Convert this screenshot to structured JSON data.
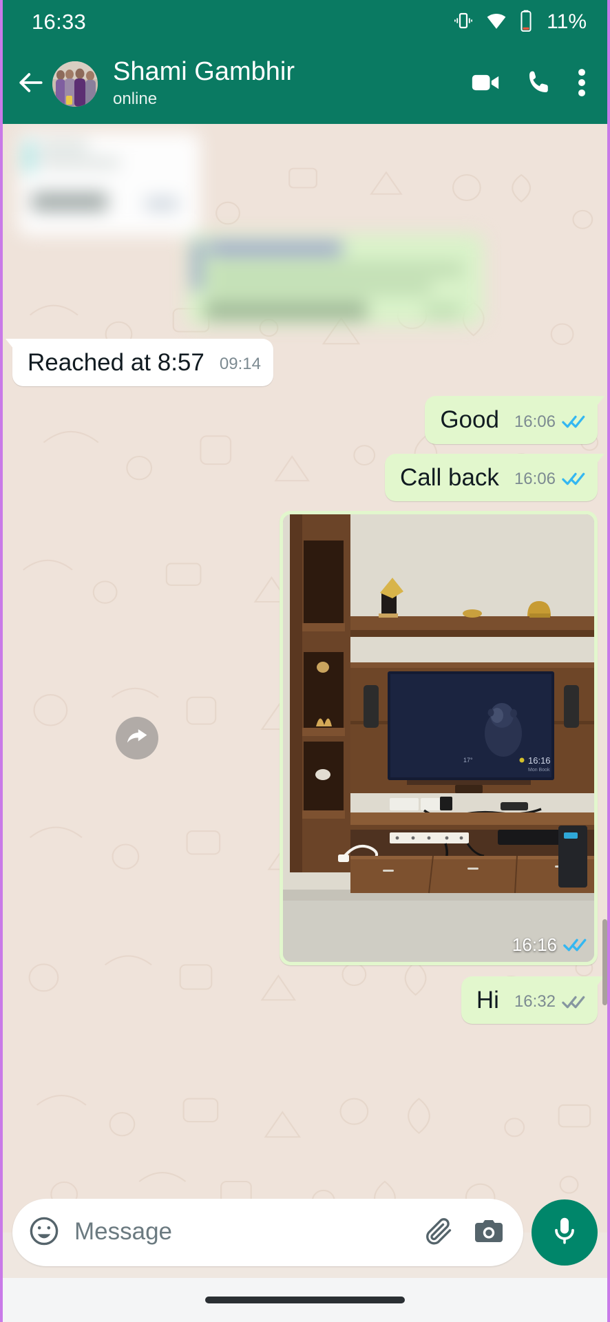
{
  "status_bar": {
    "time": "16:33",
    "battery_text": "11%",
    "icons": [
      "vibrate-icon",
      "wifi-icon",
      "battery-icon"
    ]
  },
  "chat_header": {
    "back_icon": "back-arrow-icon",
    "avatar_alt": "contact-avatar",
    "contact_name": "Shami Gambhir",
    "presence": "online",
    "actions": [
      "video-call-icon",
      "voice-call-icon",
      "overflow-menu-icon"
    ]
  },
  "theme": {
    "header_green": "#0a7a62",
    "outgoing_bubble": "#e2f7cd",
    "incoming_bubble": "#ffffff",
    "wallpaper": "#efe3da",
    "read_tick_blue": "#34b7f1",
    "sent_tick_gray": "#8696a0",
    "mic_green": "#00866a",
    "screen_border": "#c97ae8"
  },
  "messages": [
    {
      "id": "msg-blurred-incoming",
      "direction": "incoming",
      "blurred": true,
      "text": "",
      "time": ""
    },
    {
      "id": "msg-blurred-outgoing",
      "direction": "outgoing",
      "blurred": true,
      "text": "",
      "time": ""
    },
    {
      "id": "msg-reached",
      "direction": "incoming",
      "type": "text",
      "text": "Reached at 8:57",
      "time": "09:14",
      "status": "none"
    },
    {
      "id": "msg-good",
      "direction": "outgoing",
      "type": "text",
      "text": "Good",
      "time": "16:06",
      "status": "read"
    },
    {
      "id": "msg-callback",
      "direction": "outgoing",
      "type": "text",
      "text": "Call back",
      "time": "16:06",
      "status": "read"
    },
    {
      "id": "msg-photo",
      "direction": "outgoing",
      "type": "image",
      "caption": "",
      "time": "16:16",
      "status": "read",
      "forward_icon": "forward-icon",
      "image_description": "Living room wooden TV unit with wall-mounted television showing a monkey"
    },
    {
      "id": "msg-hi",
      "direction": "outgoing",
      "type": "text",
      "text": "Hi",
      "time": "16:32",
      "status": "delivered"
    }
  ],
  "input_bar": {
    "emoji_icon": "emoji-icon",
    "placeholder": "Message",
    "attach_icon": "paperclip-icon",
    "camera_icon": "camera-icon",
    "mic_icon": "microphone-icon"
  },
  "nav_bar": {
    "gesture_pill": "home-gesture-pill"
  }
}
